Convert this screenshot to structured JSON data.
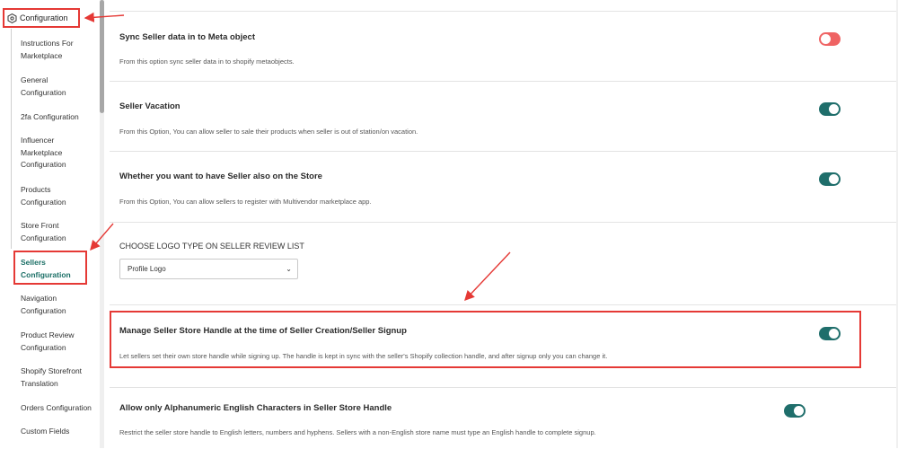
{
  "sidebar": {
    "section_title": "Configuration",
    "items": [
      {
        "label": "Instructions For Marketplace",
        "lines": [
          "Instructions For",
          "Marketplace"
        ],
        "active": false
      },
      {
        "label": "General Configuration",
        "lines": [
          "General",
          "Configuration"
        ],
        "active": false
      },
      {
        "label": "2fa Configuration",
        "lines": [
          "2fa Configuration"
        ],
        "active": false
      },
      {
        "label": "Influencer Marketplace Configuration",
        "lines": [
          "Influencer",
          "Marketplace",
          "Configuration"
        ],
        "active": false
      },
      {
        "label": "Products Configuration",
        "lines": [
          "Products",
          "Configuration"
        ],
        "active": false
      },
      {
        "label": "Store Front Configuration",
        "lines": [
          "Store Front",
          "Configuration"
        ],
        "active": false
      },
      {
        "label": "Sellers Configuration",
        "lines": [
          "Sellers",
          "Configuration"
        ],
        "active": true
      },
      {
        "label": "Navigation Configuration",
        "lines": [
          "Navigation",
          "Configuration"
        ],
        "active": false
      },
      {
        "label": "Product Review Configuration",
        "lines": [
          "Product Review",
          "Configuration"
        ],
        "active": false
      },
      {
        "label": "Shopify Storefront Translation",
        "lines": [
          "Shopify Storefront",
          "Translation"
        ],
        "active": false
      },
      {
        "label": "Orders Configuration",
        "lines": [
          "Orders Configuration"
        ],
        "active": false
      },
      {
        "label": "Custom Fields",
        "lines": [
          "Custom Fields"
        ],
        "active": false
      }
    ]
  },
  "settings": [
    {
      "title": "Sync Seller data in to Meta object",
      "description": "From this option sync seller data in to shopify metaobjects.",
      "enabled": false
    },
    {
      "title": "Seller Vacation",
      "description": "From this Option, You can allow seller to sale their products when seller is out of station/on vacation.",
      "enabled": true
    },
    {
      "title": "Whether you want to have Seller also on the Store",
      "description": "From this Option, You can allow sellers to register with Multivendor marketplace app.",
      "enabled": true
    },
    {
      "title": "Manage Seller Store Handle at the time of Seller Creation/Seller Signup",
      "description": "Let sellers set their own store handle while signing up. The handle is kept in sync with the seller's Shopify collection handle, and after signup only you can change it.",
      "enabled": true
    },
    {
      "title": "Allow only Alphanumeric English Characters in Seller Store Handle",
      "description": "Restrict the seller store handle to English letters, numbers and hyphens. Sellers with a non-English store name must type an English handle to complete signup.",
      "enabled": true
    }
  ],
  "logo_type": {
    "title": "CHOOSE LOGO TYPE ON SELLER REVIEW LIST",
    "selected": "Profile Logo"
  },
  "colors": {
    "toggle_on": "#1f6e6b",
    "toggle_off": "#ef6363",
    "annotation_red": "#e53935",
    "active_text": "#1b6f66"
  }
}
